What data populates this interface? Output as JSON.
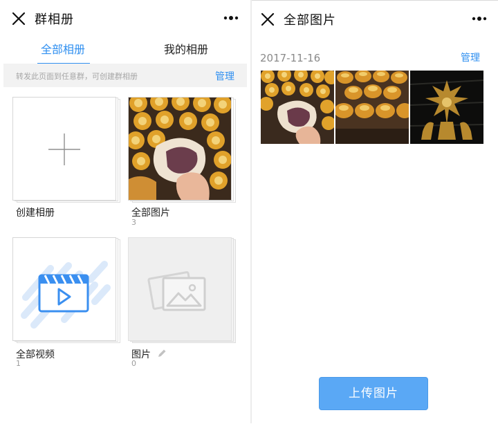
{
  "left": {
    "title": "群相册",
    "tabs": [
      {
        "label": "全部相册",
        "active": true
      },
      {
        "label": "我的相册",
        "active": false
      }
    ],
    "tip": "转发此页面到任意群，可创建群相册",
    "manage_label": "管理",
    "albums": [
      {
        "name": "创建相册",
        "count": ""
      },
      {
        "name": "全部图片",
        "count": "3"
      },
      {
        "name": "全部视频",
        "count": "1"
      },
      {
        "name": "图片",
        "count": "0"
      }
    ]
  },
  "right": {
    "title": "全部图片",
    "date": "2017-11-16",
    "manage_label": "管理",
    "photos": [
      {
        "subject": "mooncake-hand"
      },
      {
        "subject": "egg-yolk-pastries"
      },
      {
        "subject": "golden-figure"
      }
    ],
    "upload_label": "上传图片"
  },
  "icons": [
    "close-icon",
    "more-icon",
    "plus-icon",
    "video-icon",
    "image-placeholder-icon",
    "edit-pencil-icon"
  ],
  "colors": {
    "accent": "#2f8ff0",
    "upload_button": "#5aa8f5",
    "tip_background": "#f2f2f2"
  }
}
